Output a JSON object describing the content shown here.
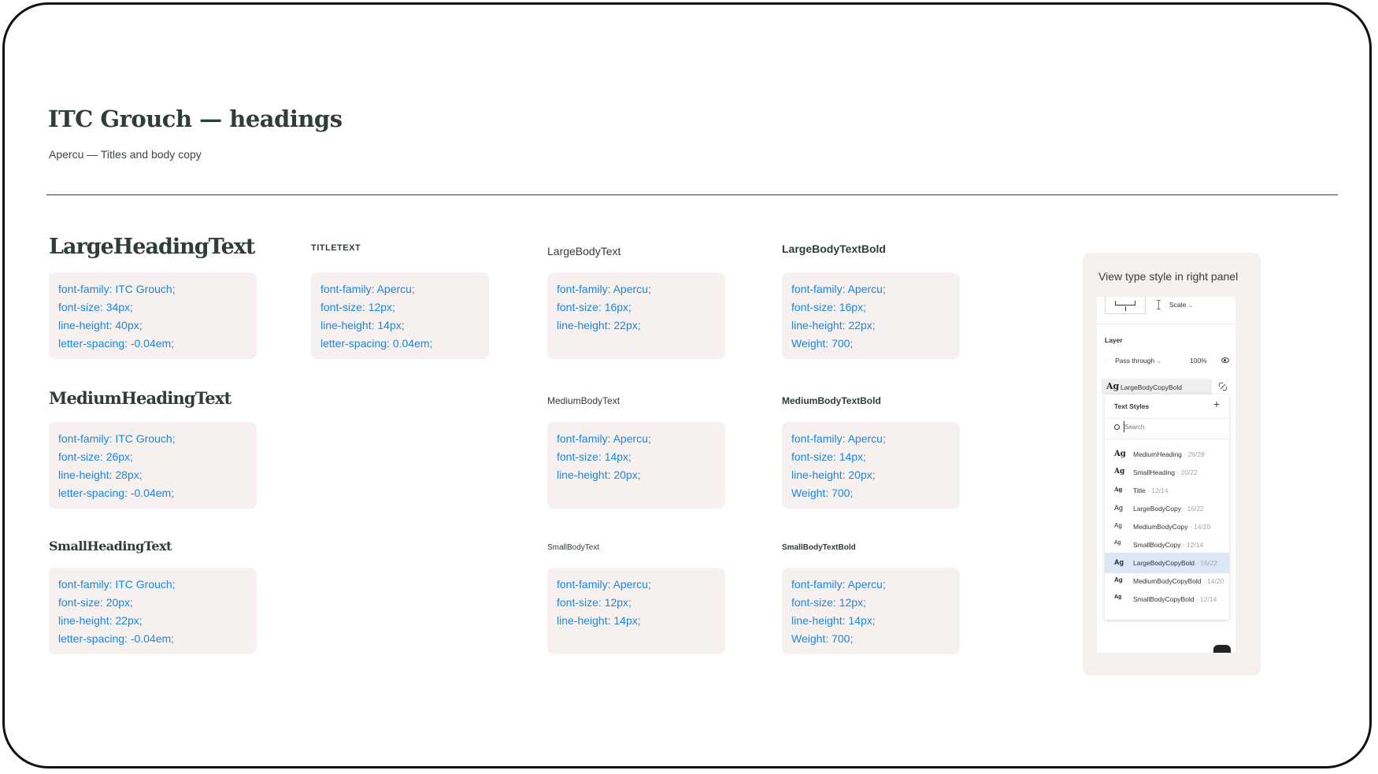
{
  "header": {
    "title": "ITC Grouch — headings",
    "subtitle": "Apercu — Titles and body copy"
  },
  "styles": {
    "large_heading": {
      "label": "LargeHeadingText",
      "specs": [
        "font-family: ITC Grouch;",
        "font-size: 34px;",
        "line-height: 40px;",
        "letter-spacing: -0.04em;"
      ]
    },
    "medium_heading": {
      "label": "MediumHeadingText",
      "specs": [
        "font-family: ITC Grouch;",
        "font-size: 26px;",
        "line-height: 28px;",
        "letter-spacing: -0.04em;"
      ]
    },
    "small_heading": {
      "label": "SmallHeadingText",
      "specs": [
        "font-family: ITC Grouch;",
        "font-size: 20px;",
        "line-height: 22px;",
        "letter-spacing: -0.04em;"
      ]
    },
    "title_text": {
      "label": "TITLETEXT",
      "specs": [
        "font-family: Apercu;",
        "font-size: 12px;",
        "line-height: 14px;",
        "letter-spacing: 0.04em;"
      ]
    },
    "large_body": {
      "label": "LargeBodyText",
      "specs": [
        "font-family: Apercu;",
        "font-size: 16px;",
        "line-height: 22px;"
      ]
    },
    "medium_body": {
      "label": "MediumBodyText",
      "specs": [
        "font-family: Apercu;",
        "font-size: 14px;",
        "line-height: 20px;"
      ]
    },
    "small_body": {
      "label": "SmallBodyText",
      "specs": [
        "font-family: Apercu;",
        "font-size: 12px;",
        "line-height: 14px;"
      ]
    },
    "large_body_bold": {
      "label": "LargeBodyTextBold",
      "specs": [
        "font-family: Apercu;",
        "font-size: 16px;",
        "line-height: 22px;",
        "Weight: 700;"
      ]
    },
    "medium_body_bold": {
      "label": "MediumBodyTextBold",
      "specs": [
        "font-family: Apercu;",
        "font-size: 14px;",
        "line-height: 20px;",
        "Weight: 700;"
      ]
    },
    "small_body_bold": {
      "label": "SmallBodyTextBold",
      "specs": [
        "font-family: Apercu;",
        "font-size: 12px;",
        "line-height: 14px;",
        "Weight: 700;"
      ]
    }
  },
  "panel": {
    "caption": "View type style in right panel",
    "scale_label": "Scale",
    "layer_heading": "Layer",
    "blend_mode": "Pass through",
    "opacity": "100%",
    "current_style": "LargeBodyCopyBold",
    "ag_glyph": "Ag",
    "dropdown": {
      "title": "Text Styles",
      "add_glyph": "+",
      "search_placeholder": "Search",
      "items": [
        {
          "name": "MediumHeading",
          "meta": " · 26/28"
        },
        {
          "name": "SmallHeading",
          "meta": " · 20/22"
        },
        {
          "name": "Title",
          "meta": " · 12/14"
        },
        {
          "name": "LargeBodyCopy",
          "meta": " · 16/22"
        },
        {
          "name": "MediumBodyCopy",
          "meta": " · 14/20"
        },
        {
          "name": "SmallBodyCopy",
          "meta": " · 12/14"
        },
        {
          "name": "LargeBodyCopyBold",
          "meta": " · 16/22"
        },
        {
          "name": "MediumBodyCopyBold",
          "meta": " · 14/20"
        },
        {
          "name": "SmallBodyCopyBold",
          "meta": " · 12/14"
        }
      ]
    }
  },
  "colors": {
    "spec_text": "#1b86dc",
    "card_bg": "#f6f1ee",
    "heading": "#2f3d39",
    "selected_row": "#dbe7f4"
  }
}
